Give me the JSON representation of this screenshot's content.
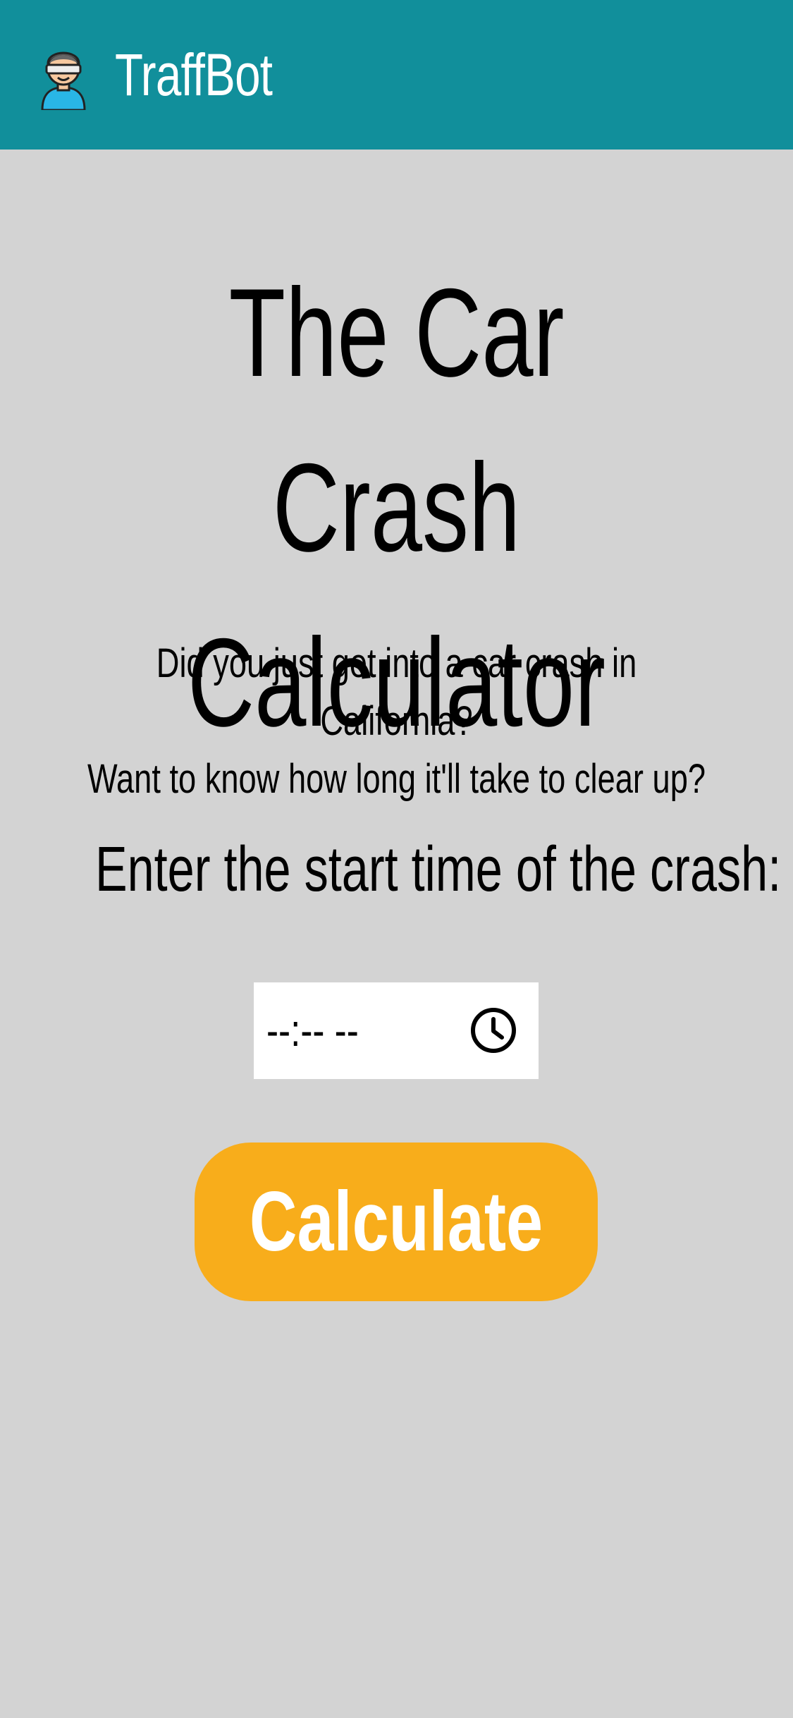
{
  "header": {
    "brand": "TraffBot",
    "logo_icon": "robot-avatar-icon",
    "background_color": "#118f9b"
  },
  "main": {
    "title_lines": [
      "The Car Crash",
      "Calculator"
    ],
    "subtitle_lines": [
      "Did you just get into a car crash in California?",
      "Want to know how long it'll take to clear up?"
    ],
    "prompt": "Enter the start time of the crash:",
    "time_input": {
      "value_display": "--:-- --",
      "icon": "clock-icon"
    },
    "calculate_button": {
      "label": "Calculate",
      "color": "#f8ad1b"
    }
  },
  "page": {
    "background_color": "#d3d3d3"
  }
}
